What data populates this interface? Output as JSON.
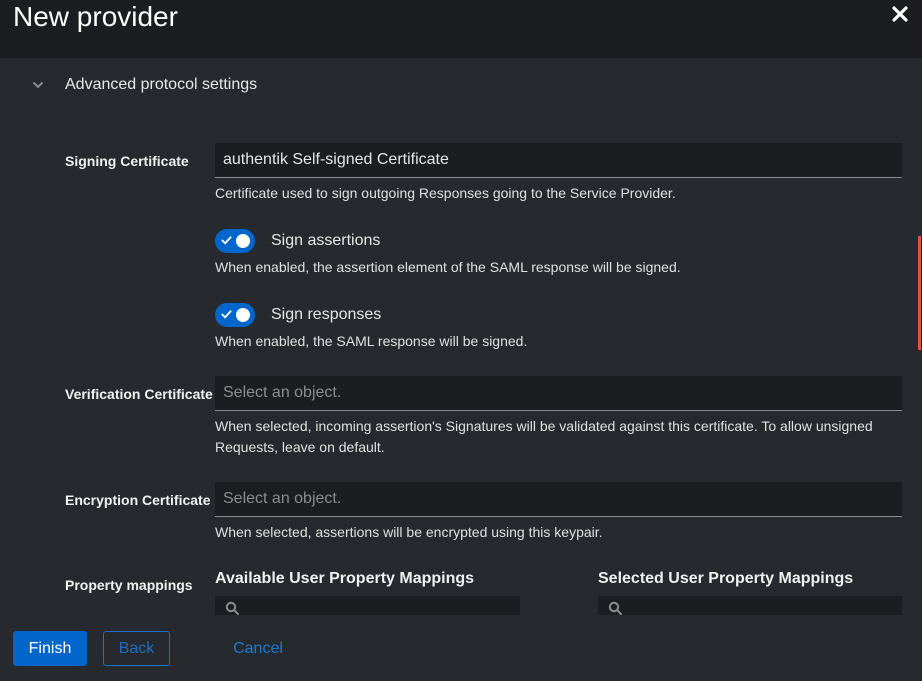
{
  "header": {
    "title": "New provider"
  },
  "section": {
    "label": "Advanced protocol settings"
  },
  "signing": {
    "label": "Signing Certificate",
    "value": "authentik Self-signed Certificate",
    "helper": "Certificate used to sign outgoing Responses going to the Service Provider."
  },
  "sign_assertions": {
    "label": "Sign assertions",
    "helper": "When enabled, the assertion element of the SAML response will be signed.",
    "enabled": true
  },
  "sign_responses": {
    "label": "Sign responses",
    "helper": "When enabled, the SAML response will be signed.",
    "enabled": true
  },
  "verification": {
    "label": "Verification Certificate",
    "placeholder": "Select an object.",
    "helper": "When selected, incoming assertion's Signatures will be validated against this certificate. To allow unsigned Requests, leave on default."
  },
  "encryption": {
    "label": "Encryption Certificate",
    "placeholder": "Select an object.",
    "helper": "When selected, assertions will be encrypted using this keypair."
  },
  "mappings": {
    "label": "Property mappings",
    "available_title": "Available User Property Mappings",
    "selected_title": "Selected User Property Mappings"
  },
  "footer": {
    "finish": "Finish",
    "back": "Back",
    "cancel": "Cancel"
  },
  "colors": {
    "accent": "#0066cc",
    "scroll_indicator": "#e0553a",
    "background": "#26292d",
    "header": "#1b1d21"
  },
  "icons": {
    "close": "close-icon",
    "chevron": "chevron-down-icon",
    "check": "check-icon",
    "search": "search-icon"
  }
}
